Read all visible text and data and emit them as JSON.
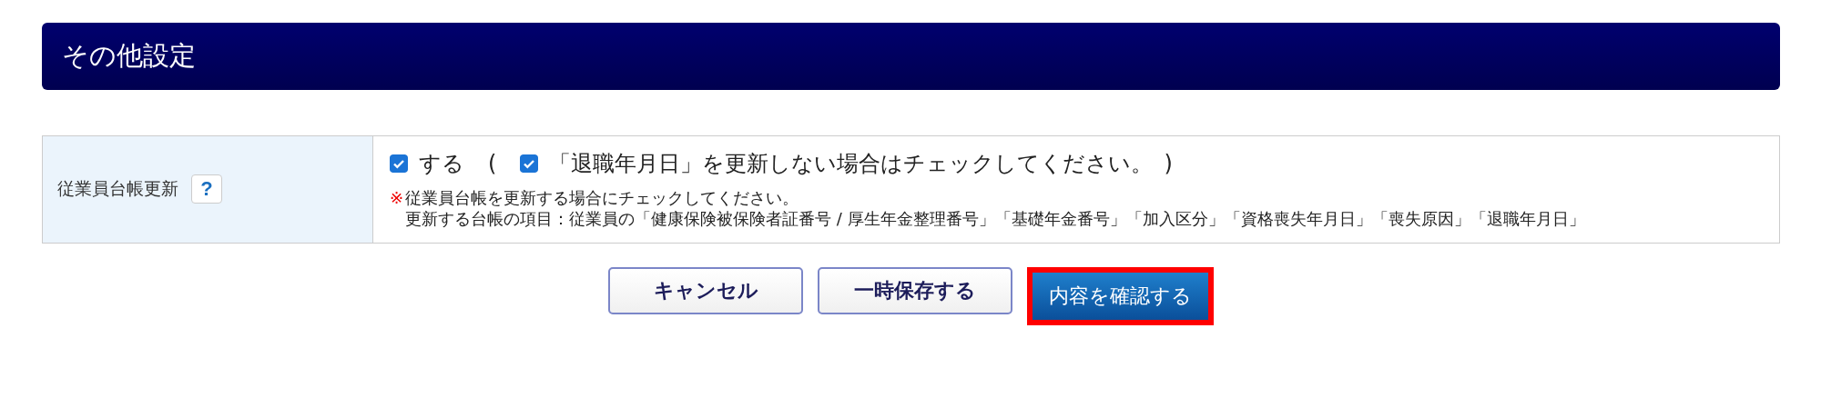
{
  "section": {
    "title": "その他設定"
  },
  "form_row": {
    "label": "従業員台帳更新",
    "help": "?",
    "options": [
      {
        "label": "する",
        "checked": true
      },
      {
        "label": "「退職年月日」を更新しない場合はチェックしてください。",
        "checked": true
      }
    ],
    "paren_open": "(",
    "paren_close": ")",
    "note_mark": "※",
    "note_lines": [
      "従業員台帳を更新する場合にチェックしてください。",
      "更新する台帳の項目：従業員の「健康保険被保険者証番号 / 厚生年金整理番号」「基礎年金番号」「加入区分」「資格喪失年月日」「喪失原因」「退職年月日」"
    ]
  },
  "buttons": [
    {
      "label": "キャンセル",
      "kind": "secondary",
      "highlighted": false
    },
    {
      "label": "一時保存する",
      "kind": "secondary",
      "highlighted": false
    },
    {
      "label": "内容を確認する",
      "kind": "primary",
      "highlighted": true
    }
  ]
}
